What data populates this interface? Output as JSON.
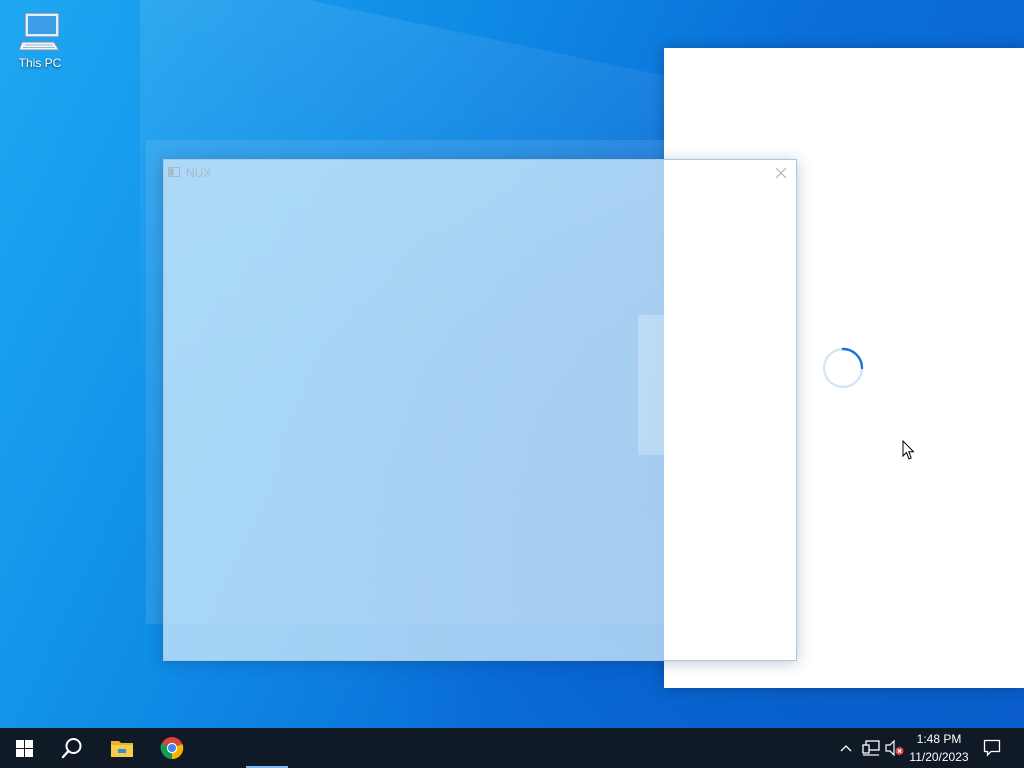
{
  "desktop": {
    "icons": [
      {
        "label": "This PC",
        "icon": "this-pc-icon"
      }
    ]
  },
  "nux_window": {
    "title": "NUX",
    "icon": "app-window-icon",
    "close_icon": "close-icon"
  },
  "loading_window": {
    "spinner": "loading-spinner-icon",
    "accent": "#1a73d6"
  },
  "taskbar": {
    "start_icon": "windows-start-icon",
    "search_icon": "search-icon",
    "pinned": [
      {
        "name": "File Explorer",
        "icon": "file-explorer-icon"
      },
      {
        "name": "Google Chrome",
        "icon": "chrome-icon"
      }
    ],
    "tray": {
      "overflow_icon": "chevron-up-icon",
      "network_icon": "network-icon",
      "volume_icon": "volume-muted-icon",
      "time": "1:48 PM",
      "date": "11/20/2023",
      "notifications_icon": "action-center-icon"
    },
    "colors": {
      "background": "#0f1a26",
      "text": "#ffffff"
    }
  }
}
